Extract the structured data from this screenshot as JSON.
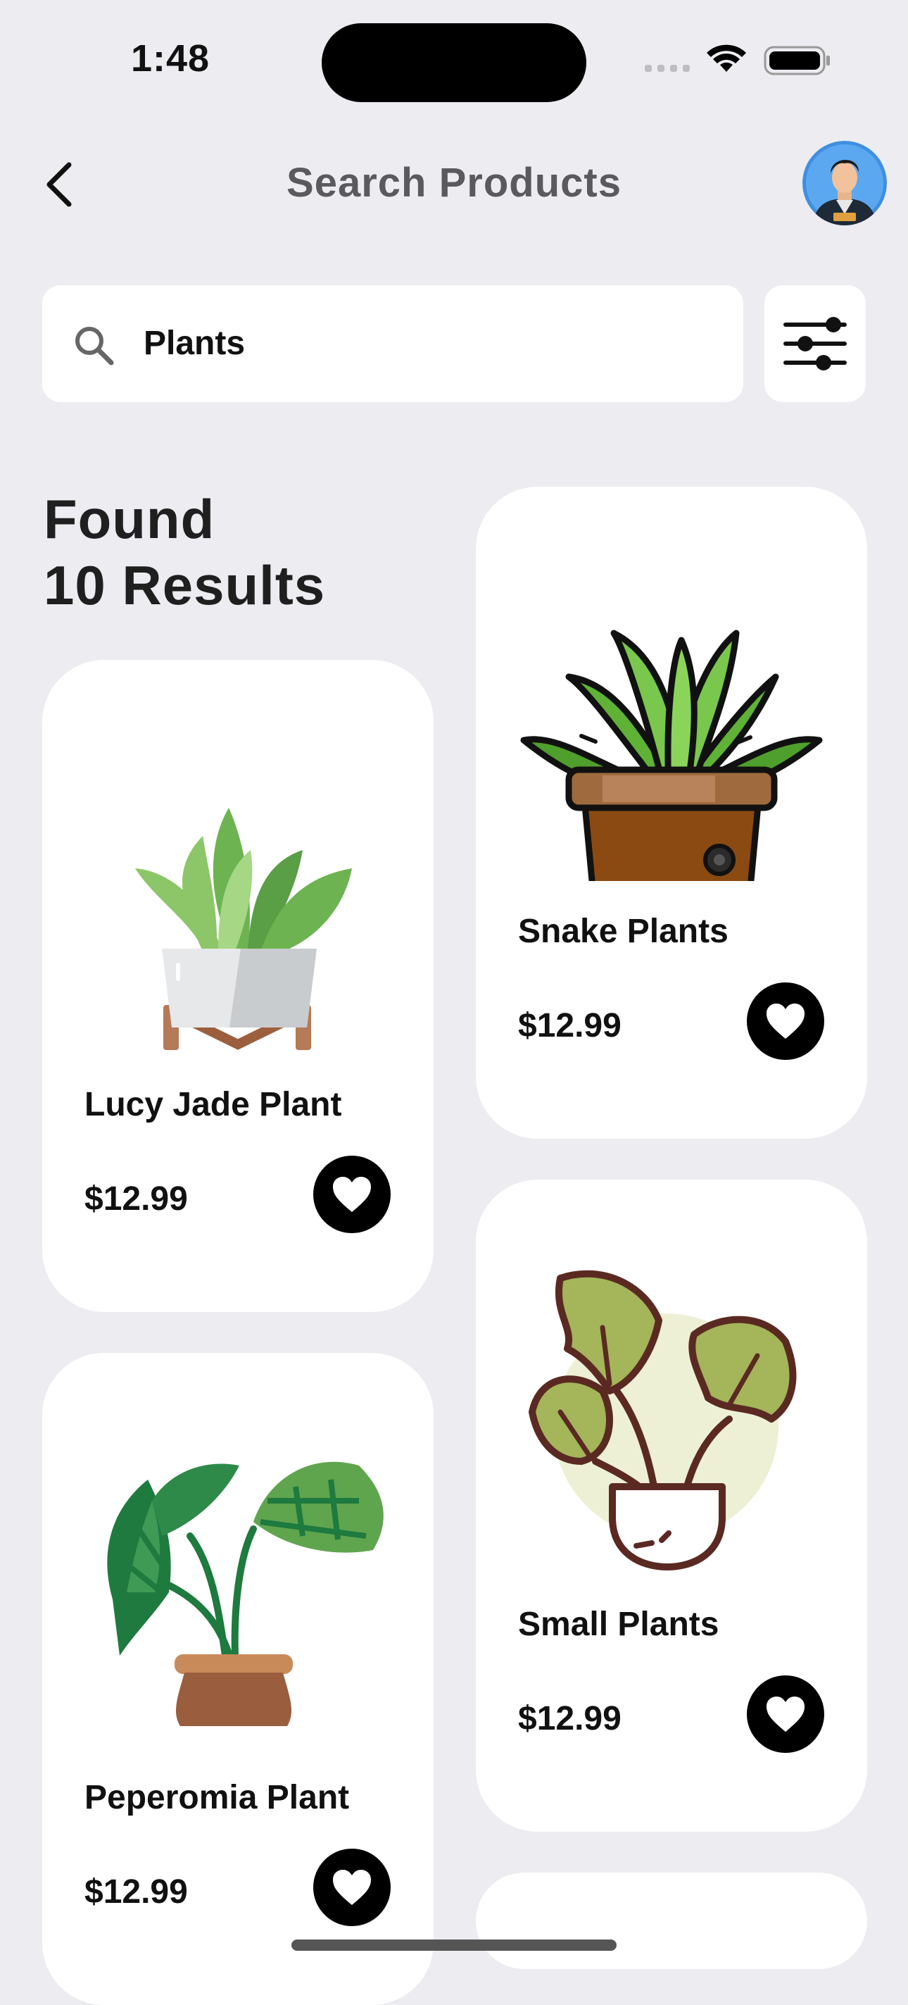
{
  "status_bar": {
    "time": "1:48"
  },
  "header": {
    "title": "Search Products",
    "back_icon": "chevron-left-icon",
    "avatar_icon": "user-avatar"
  },
  "search": {
    "value": "Plants",
    "placeholder": "Search",
    "icon": "search-icon",
    "filter_icon": "sliders-icon"
  },
  "results": {
    "line1": "Found",
    "line2": "10 Results"
  },
  "products": [
    {
      "name": "Lucy Jade Plant",
      "price": "$12.99",
      "icon": "potted-plant-icon"
    },
    {
      "name": "Snake Plants",
      "price": "$12.99",
      "icon": "snake-plant-icon"
    },
    {
      "name": "Peperomia Plant",
      "price": "$12.99",
      "icon": "alocasia-plant-icon"
    },
    {
      "name": "Small Plants",
      "price": "$12.99",
      "icon": "monstera-plant-icon"
    }
  ],
  "colors": {
    "background": "#ECECF1",
    "card": "#FFFFFF",
    "favorite_button": "#000000",
    "title_gray": "#5A5A5E"
  }
}
